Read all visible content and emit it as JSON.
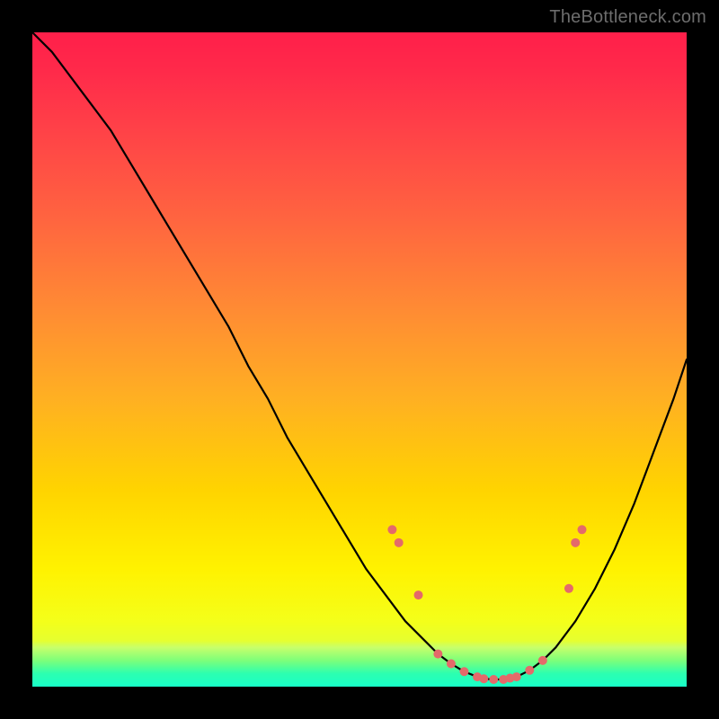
{
  "watermark": {
    "text": "TheBottleneck.com"
  },
  "chart_data": {
    "type": "line",
    "title": "",
    "xlabel": "",
    "ylabel": "",
    "xlim": [
      0,
      100
    ],
    "ylim": [
      0,
      100
    ],
    "grid": false,
    "legend": false,
    "background_gradient_stops": [
      {
        "pos": 0,
        "color": "#ff1f4a"
      },
      {
        "pos": 28,
        "color": "#ff6340"
      },
      {
        "pos": 56,
        "color": "#ffb022"
      },
      {
        "pos": 82,
        "color": "#fff200"
      },
      {
        "pos": 96,
        "color": "#d7ff45"
      },
      {
        "pos": 100,
        "color": "#18ffc8"
      }
    ],
    "series": [
      {
        "name": "bottleneck-curve",
        "color": "#000000",
        "x": [
          0,
          3,
          6,
          9,
          12,
          15,
          18,
          21,
          24,
          27,
          30,
          33,
          36,
          39,
          42,
          45,
          48,
          51,
          54,
          57,
          60,
          62,
          64,
          66,
          68,
          70,
          72,
          74,
          76,
          78,
          80,
          83,
          86,
          89,
          92,
          95,
          98,
          100
        ],
        "y": [
          100,
          97,
          93,
          89,
          85,
          80,
          75,
          70,
          65,
          60,
          55,
          49,
          44,
          38,
          33,
          28,
          23,
          18,
          14,
          10,
          7,
          5,
          3.5,
          2.3,
          1.5,
          1.1,
          1.1,
          1.5,
          2.5,
          4,
          6,
          10,
          15,
          21,
          28,
          36,
          44,
          50
        ]
      }
    ],
    "markers": {
      "name": "highlighted-points",
      "color": "#e46a6a",
      "radius": 5,
      "points": [
        {
          "x": 55,
          "y": 24
        },
        {
          "x": 56,
          "y": 22
        },
        {
          "x": 59,
          "y": 14
        },
        {
          "x": 62,
          "y": 5
        },
        {
          "x": 64,
          "y": 3.5
        },
        {
          "x": 66,
          "y": 2.3
        },
        {
          "x": 68,
          "y": 1.5
        },
        {
          "x": 69,
          "y": 1.2
        },
        {
          "x": 70.5,
          "y": 1.1
        },
        {
          "x": 72,
          "y": 1.1
        },
        {
          "x": 73,
          "y": 1.3
        },
        {
          "x": 74,
          "y": 1.5
        },
        {
          "x": 76,
          "y": 2.5
        },
        {
          "x": 78,
          "y": 4
        },
        {
          "x": 82,
          "y": 15
        },
        {
          "x": 83,
          "y": 22
        },
        {
          "x": 84,
          "y": 24
        }
      ]
    }
  }
}
